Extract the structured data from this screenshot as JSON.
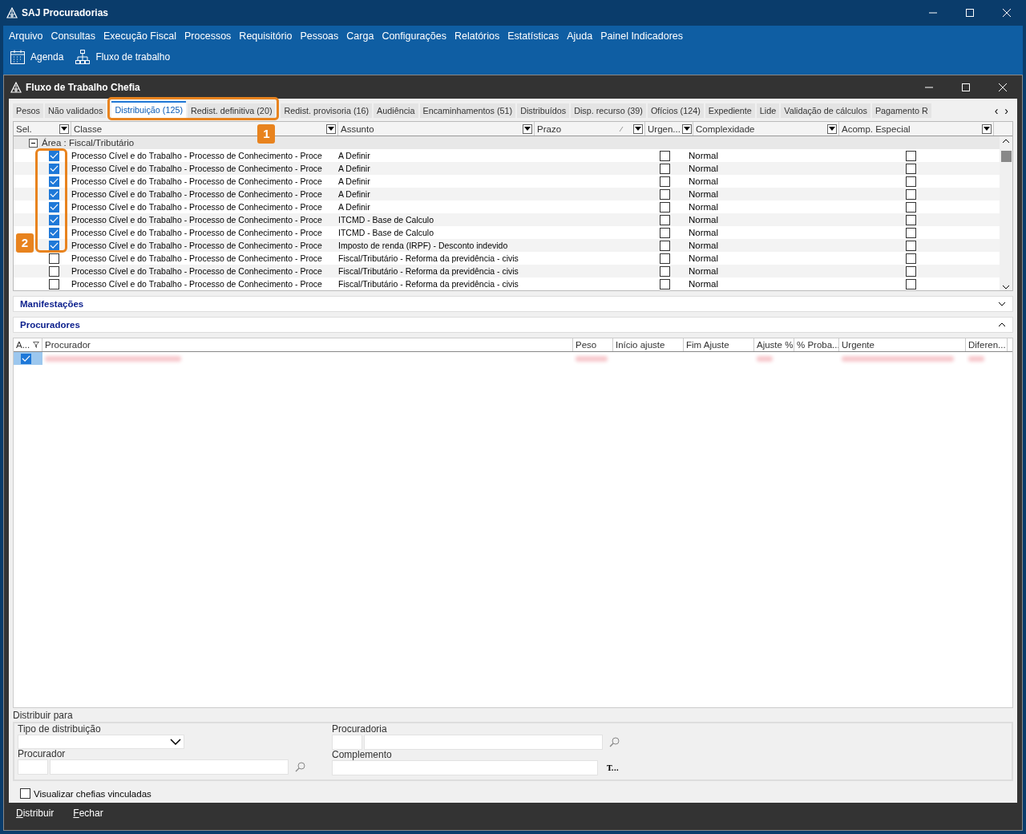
{
  "app": {
    "title": "SAJ Procuradorias"
  },
  "menu": [
    "Arquivo",
    "Consultas",
    "Execução Fiscal",
    "Processos",
    "Requisitório",
    "Pessoas",
    "Carga",
    "Configurações",
    "Relatórios",
    "Estatísticas",
    "Ajuda",
    "Painel Indicadores"
  ],
  "toolbar": [
    {
      "kind": "calendar",
      "label": "Agenda"
    },
    {
      "kind": "workflow",
      "label": "Fluxo de trabalho"
    }
  ],
  "window": {
    "title": "Fluxo de Trabalho Chefia"
  },
  "tabs": [
    {
      "label": "Pesos",
      "selected": false,
      "highlighted": false
    },
    {
      "label": "Não validados",
      "selected": false,
      "highlighted": false
    },
    {
      "label": "Distribuição (125)",
      "selected": true,
      "highlighted": true
    },
    {
      "label": "Redist. definitiva (20)",
      "selected": false,
      "highlighted": true
    },
    {
      "label": "Redist. provisoria (16)",
      "selected": false,
      "highlighted": false
    },
    {
      "label": "Audiência",
      "selected": false,
      "highlighted": false
    },
    {
      "label": "Encaminhamentos (51)",
      "selected": false,
      "highlighted": false
    },
    {
      "label": "Distribuídos",
      "selected": false,
      "highlighted": false
    },
    {
      "label": "Disp. recurso (39)",
      "selected": false,
      "highlighted": false
    },
    {
      "label": "Ofícios (124)",
      "selected": false,
      "highlighted": false
    },
    {
      "label": "Expediente",
      "selected": false,
      "highlighted": false
    },
    {
      "label": "Lide",
      "selected": false,
      "highlighted": false
    },
    {
      "label": "Validação de cálculos",
      "selected": false,
      "highlighted": false
    },
    {
      "label": "Pagamento R",
      "selected": false,
      "highlighted": false
    }
  ],
  "tab_nav": [
    "‹",
    "›"
  ],
  "annotations": [
    {
      "label": "1"
    },
    {
      "label": "2"
    }
  ],
  "grid": {
    "columns": [
      "Sel.",
      "Classe",
      "Assunto",
      "Prazo",
      "Urgen...",
      "Complexidade",
      "Acomp. Especial"
    ],
    "group": {
      "label": "Área : Fiscal/Tributário",
      "expanded": true
    },
    "rows": [
      {
        "checked": true,
        "classe": "Processo Cível e do Trabalho - Processo de Conhecimento - Proce",
        "assunto": "A Definir",
        "urgente": false,
        "complexidade": "Normal",
        "acomp": false
      },
      {
        "checked": true,
        "classe": "Processo Cível e do Trabalho - Processo de Conhecimento - Proce",
        "assunto": "A Definir",
        "urgente": false,
        "complexidade": "Normal",
        "acomp": false
      },
      {
        "checked": true,
        "classe": "Processo Cível e do Trabalho - Processo de Conhecimento - Proce",
        "assunto": "A Definir",
        "urgente": false,
        "complexidade": "Normal",
        "acomp": false
      },
      {
        "checked": true,
        "classe": "Processo Cível e do Trabalho - Processo de Conhecimento - Proce",
        "assunto": "A Definir",
        "urgente": false,
        "complexidade": "Normal",
        "acomp": false
      },
      {
        "checked": true,
        "classe": "Processo Cível e do Trabalho - Processo de Conhecimento - Proce",
        "assunto": "A Definir",
        "urgente": false,
        "complexidade": "Normal",
        "acomp": false
      },
      {
        "checked": true,
        "classe": "Processo Cível e do Trabalho - Processo de Conhecimento - Proce",
        "assunto": "ITCMD - Base de Calculo",
        "urgente": false,
        "complexidade": "Normal",
        "acomp": false
      },
      {
        "checked": true,
        "classe": "Processo Cível e do Trabalho - Processo de Conhecimento - Proce",
        "assunto": "ITCMD - Base de Calculo",
        "urgente": false,
        "complexidade": "Normal",
        "acomp": false
      },
      {
        "checked": true,
        "classe": "Processo Cível e do Trabalho - Processo de Conhecimento - Proce",
        "assunto": "Imposto de renda (IRPF) - Desconto indevido",
        "urgente": false,
        "complexidade": "Normal",
        "acomp": false
      },
      {
        "checked": false,
        "classe": "Processo Cível e do Trabalho - Processo de Conhecimento - Proce",
        "assunto": "Fiscal/Tributário - Reforma da previdência - civis",
        "urgente": false,
        "complexidade": "Normal",
        "acomp": false
      },
      {
        "checked": false,
        "classe": "Processo Cível e do Trabalho - Processo de Conhecimento - Proce",
        "assunto": "Fiscal/Tributário - Reforma da previdência - civis",
        "urgente": false,
        "complexidade": "Normal",
        "acomp": false
      },
      {
        "checked": false,
        "classe": "Processo Cível e do Trabalho - Processo de Conhecimento - Proce",
        "assunto": "Fiscal/Tributário - Reforma da previdência - civis",
        "urgente": false,
        "complexidade": "Normal",
        "acomp": false
      }
    ]
  },
  "sections": [
    {
      "title": "Manifestações",
      "expanded": false
    },
    {
      "title": "Procuradores",
      "expanded": true
    }
  ],
  "procuradores": {
    "columns": [
      "A...",
      "Procurador",
      "Peso",
      "Início ajuste",
      "Fim Ajuste",
      "Ajuste %",
      "% Proba...",
      "Urgente",
      "Diferen..."
    ],
    "rows": [
      {
        "checked": true
      }
    ]
  },
  "distribuir": {
    "title": "Distribuir para",
    "tipo_label": "Tipo de distribuição",
    "procuradoria_label": "Procuradoria",
    "procurador_label": "Procurador",
    "complemento_label": "Complemento",
    "complemento_button": "T..."
  },
  "visualizar": {
    "label": "Visualizar chefias vinculadas",
    "checked": false
  },
  "footer_buttons": [
    "Distribuir",
    "Fechar"
  ]
}
